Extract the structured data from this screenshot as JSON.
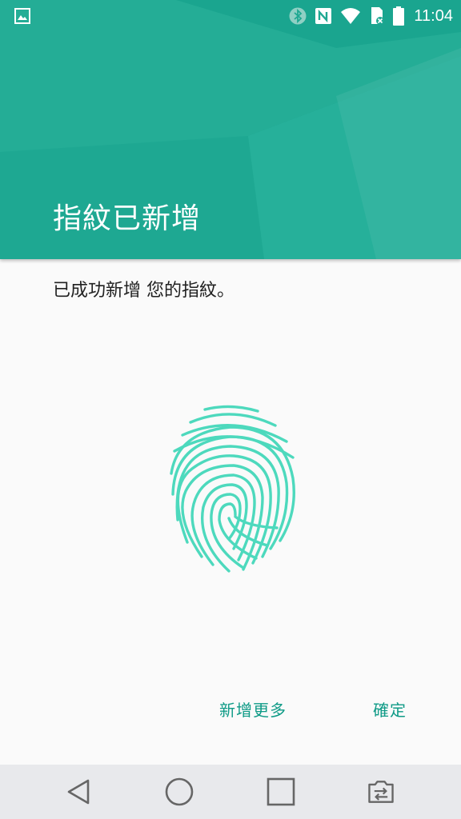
{
  "status_bar": {
    "time": "11:04",
    "icons": [
      "image-icon",
      "bluetooth-icon",
      "nfc-icon",
      "wifi-icon",
      "sim-off-icon",
      "battery-icon"
    ]
  },
  "header": {
    "title": "指紋已新增",
    "color": "#1ea892"
  },
  "body": {
    "message": "已成功新增 您的指紋。",
    "fingerprint_icon": "fingerprint-icon",
    "accent_color": "#4dd9bd"
  },
  "actions": {
    "add_more_label": "新增更多",
    "ok_label": "確定",
    "color": "#0e9a86"
  },
  "nav_bar": {
    "buttons": [
      "back-icon",
      "home-icon",
      "recents-icon",
      "dual-window-icon"
    ]
  }
}
